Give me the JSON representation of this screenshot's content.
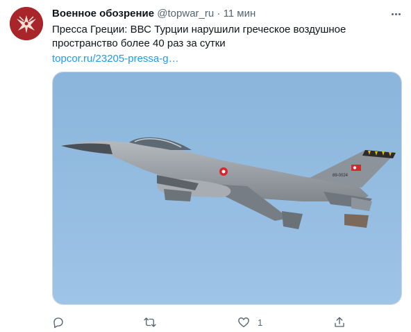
{
  "tweet": {
    "author_name": "Военное обозрение",
    "handle": "@topwar_ru",
    "separator": "·",
    "time": "11 мин",
    "text_line1": "Пресса Греции: ВВС Турции нарушили греческое воздушное",
    "text_line2": "пространство более 40 раз за сутки",
    "link": "topcor.ru/23205-pressa-g…",
    "image_tail_number": "89-0024",
    "like_count": "1"
  },
  "colors": {
    "accent": "#1d9bf0",
    "secondary_text": "#536471",
    "avatar_bg": "#a8262a",
    "sky": "#8fb8dd"
  },
  "icons": {
    "more": "more-horizontal-icon",
    "reply": "reply-icon",
    "retweet": "retweet-icon",
    "like": "heart-icon",
    "share": "share-icon"
  }
}
